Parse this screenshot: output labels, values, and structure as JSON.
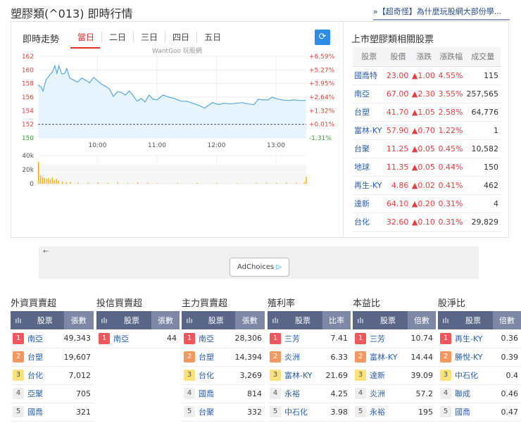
{
  "header": {
    "title": "塑膠類(^013) 即時行情",
    "promo_link": "»【超奇怪】為什麼玩股網大部份學..."
  },
  "intraday": {
    "title": "即時走勢",
    "tabs": [
      "當日",
      "二日",
      "三日",
      "四日",
      "五日"
    ],
    "active_tab": "當日",
    "refresh_icon": "refresh-icon",
    "watermark": "WantGoo 玩股網"
  },
  "chart_data": {
    "type": "line",
    "xlabel": "",
    "ylabel": "",
    "y_ticks": [
      "162",
      "160",
      "158",
      "156",
      "154",
      "152",
      "150"
    ],
    "pct_ticks": [
      "+6.59%",
      "+5.27%",
      "+3.95%",
      "+2.64%",
      "+1.32%",
      "+0.01%",
      "-1.31%"
    ],
    "x_ticks": [
      "10:00",
      "11:00",
      "12:00",
      "13:00"
    ],
    "ylim": [
      150,
      162
    ],
    "reference_price": 152,
    "price_series": {
      "minutes_from_0900": [
        0,
        3,
        5,
        8,
        12,
        15,
        17,
        19,
        21,
        24,
        27,
        29,
        32,
        36,
        40,
        44,
        48,
        52,
        56,
        60,
        64,
        68,
        72,
        76,
        80,
        84,
        88,
        92,
        96,
        100,
        104,
        108,
        112,
        116,
        120,
        126,
        132,
        138,
        144,
        150,
        156,
        162,
        168,
        172,
        176,
        182,
        188,
        194,
        200,
        206,
        212,
        218,
        222,
        226,
        232,
        236,
        240,
        246,
        252,
        258,
        264,
        270
      ],
      "values": [
        157.8,
        157.5,
        156.9,
        158.5,
        159.3,
        159.8,
        160.6,
        159.5,
        160.6,
        159.4,
        159.5,
        160.2,
        158.8,
        158.5,
        158.2,
        158.8,
        158.5,
        158.1,
        158.9,
        158.4,
        157.9,
        157.6,
        157.2,
        156.1,
        156.8,
        156.7,
        156.3,
        156.9,
        156.2,
        155.4,
        155.8,
        155.3,
        156.3,
        155.7,
        155.6,
        156.3,
        156.0,
        155.8,
        155.4,
        155.4,
        155.1,
        154.8,
        154.4,
        154.8,
        155.2,
        154.9,
        155.1,
        155.0,
        155.1,
        155.2,
        155.0,
        154.9,
        155.7,
        155.6,
        155.6,
        156.0,
        155.8,
        155.6,
        155.5,
        155.6,
        155.5,
        155.5
      ]
    },
    "volume_ticks": [
      "40k",
      "20k",
      "0"
    ],
    "volume_ylim": [
      0,
      40000
    ],
    "volume_series": {
      "minutes_from_0900": [
        0,
        2,
        4,
        6,
        8,
        10,
        12,
        14,
        16,
        18,
        20,
        24,
        28,
        32,
        40,
        50,
        60,
        70,
        80,
        90,
        100,
        110,
        120,
        140,
        160,
        180,
        200,
        220,
        230,
        240,
        250,
        260,
        268,
        270
      ],
      "values": [
        31000,
        12000,
        9000,
        8000,
        7000,
        8000,
        6000,
        9000,
        5000,
        7000,
        4000,
        3000,
        2000,
        2500,
        1500,
        1500,
        2000,
        1000,
        2500,
        1000,
        2000,
        1500,
        1000,
        1000,
        1500,
        1000,
        800,
        1000,
        1500,
        1200,
        1500,
        1500,
        2000,
        10000
      ]
    }
  },
  "related": {
    "title": "上市塑膠類相關股票",
    "columns": [
      "股票",
      "股價",
      "漲跌",
      "漲跌幅",
      "成交量"
    ],
    "rows": [
      [
        "國喬特",
        "23.00",
        "▲1.00",
        "4.55%",
        "115"
      ],
      [
        "南亞",
        "67.00",
        "▲2.30",
        "3.55%",
        "257,565"
      ],
      [
        "台塑",
        "41.70",
        "▲1.05",
        "2.58%",
        "64,776"
      ],
      [
        "富林-KY",
        "57.90",
        "▲0.70",
        "1.22%",
        "1"
      ],
      [
        "台聚",
        "11.25",
        "▲0.05",
        "0.45%",
        "10,582"
      ],
      [
        "地球",
        "11.35",
        "▲0.05",
        "0.44%",
        "150"
      ],
      [
        "再生-KY",
        "4.86",
        "▲0.02",
        "0.41%",
        "462"
      ],
      [
        "達新",
        "64.10",
        "▲0.20",
        "0.31%",
        "4"
      ],
      [
        "台化",
        "32.60",
        "▲0.10",
        "0.31%",
        "29,829"
      ]
    ]
  },
  "ad": {
    "back": "←",
    "adchoices": "AdChoices",
    "adchoices_icon": "▷"
  },
  "rankings": [
    {
      "title": "外資買賣超",
      "col_icon": "ılı",
      "col_stock": "股票",
      "col_value": "張數",
      "rows": [
        [
          "1",
          "南亞",
          "49,343"
        ],
        [
          "2",
          "台塑",
          "19,607"
        ],
        [
          "3",
          "台化",
          "7,012"
        ],
        [
          "4",
          "亞聚",
          "705"
        ],
        [
          "5",
          "國喬",
          "321"
        ]
      ]
    },
    {
      "title": "投信買賣超",
      "col_icon": "ılı",
      "col_stock": "股票",
      "col_value": "張數",
      "rows": [
        [
          "1",
          "南亞",
          "44"
        ]
      ]
    },
    {
      "title": "主力買賣超",
      "col_icon": "ılı",
      "col_stock": "股票",
      "col_value": "張數",
      "rows": [
        [
          "1",
          "南亞",
          "28,306"
        ],
        [
          "2",
          "台塑",
          "14,394"
        ],
        [
          "3",
          "台化",
          "3,269"
        ],
        [
          "4",
          "國喬",
          "814"
        ],
        [
          "5",
          "台聚",
          "332"
        ]
      ]
    },
    {
      "title": "殖利率",
      "col_icon": "ılı",
      "col_stock": "股票",
      "col_value": "比率",
      "rows": [
        [
          "1",
          "三芳",
          "7.41"
        ],
        [
          "2",
          "炎洲",
          "6.33"
        ],
        [
          "3",
          "富林-KY",
          "21.69"
        ],
        [
          "4",
          "永裕",
          "4.25"
        ],
        [
          "5",
          "中石化",
          "3.98"
        ]
      ]
    },
    {
      "title": "本益比",
      "col_icon": "ılı",
      "col_stock": "股票",
      "col_value": "倍數",
      "rows": [
        [
          "1",
          "三芳",
          "10.74"
        ],
        [
          "2",
          "富林-KY",
          "14.44"
        ],
        [
          "3",
          "達新",
          "39.09"
        ],
        [
          "4",
          "炎洲",
          "57.2"
        ],
        [
          "5",
          "永裕",
          "195"
        ]
      ]
    },
    {
      "title": "股淨比",
      "col_icon": "ılı",
      "col_stock": "股票",
      "col_value": "倍數",
      "rows": [
        [
          "1",
          "再生-KY",
          "0.36"
        ],
        [
          "2",
          "勝悅-KY",
          "0.39"
        ],
        [
          "3",
          "中石化",
          "0.4"
        ],
        [
          "4",
          "聯成",
          "0.46"
        ],
        [
          "5",
          "國喬",
          "0.47"
        ]
      ]
    }
  ],
  "colors": {
    "up": "#e04040",
    "down": "#2eaa2e",
    "line": "#5aa8e0",
    "volume": "#f5b21a",
    "header": "#5a6688",
    "link": "#2a5ea8"
  }
}
